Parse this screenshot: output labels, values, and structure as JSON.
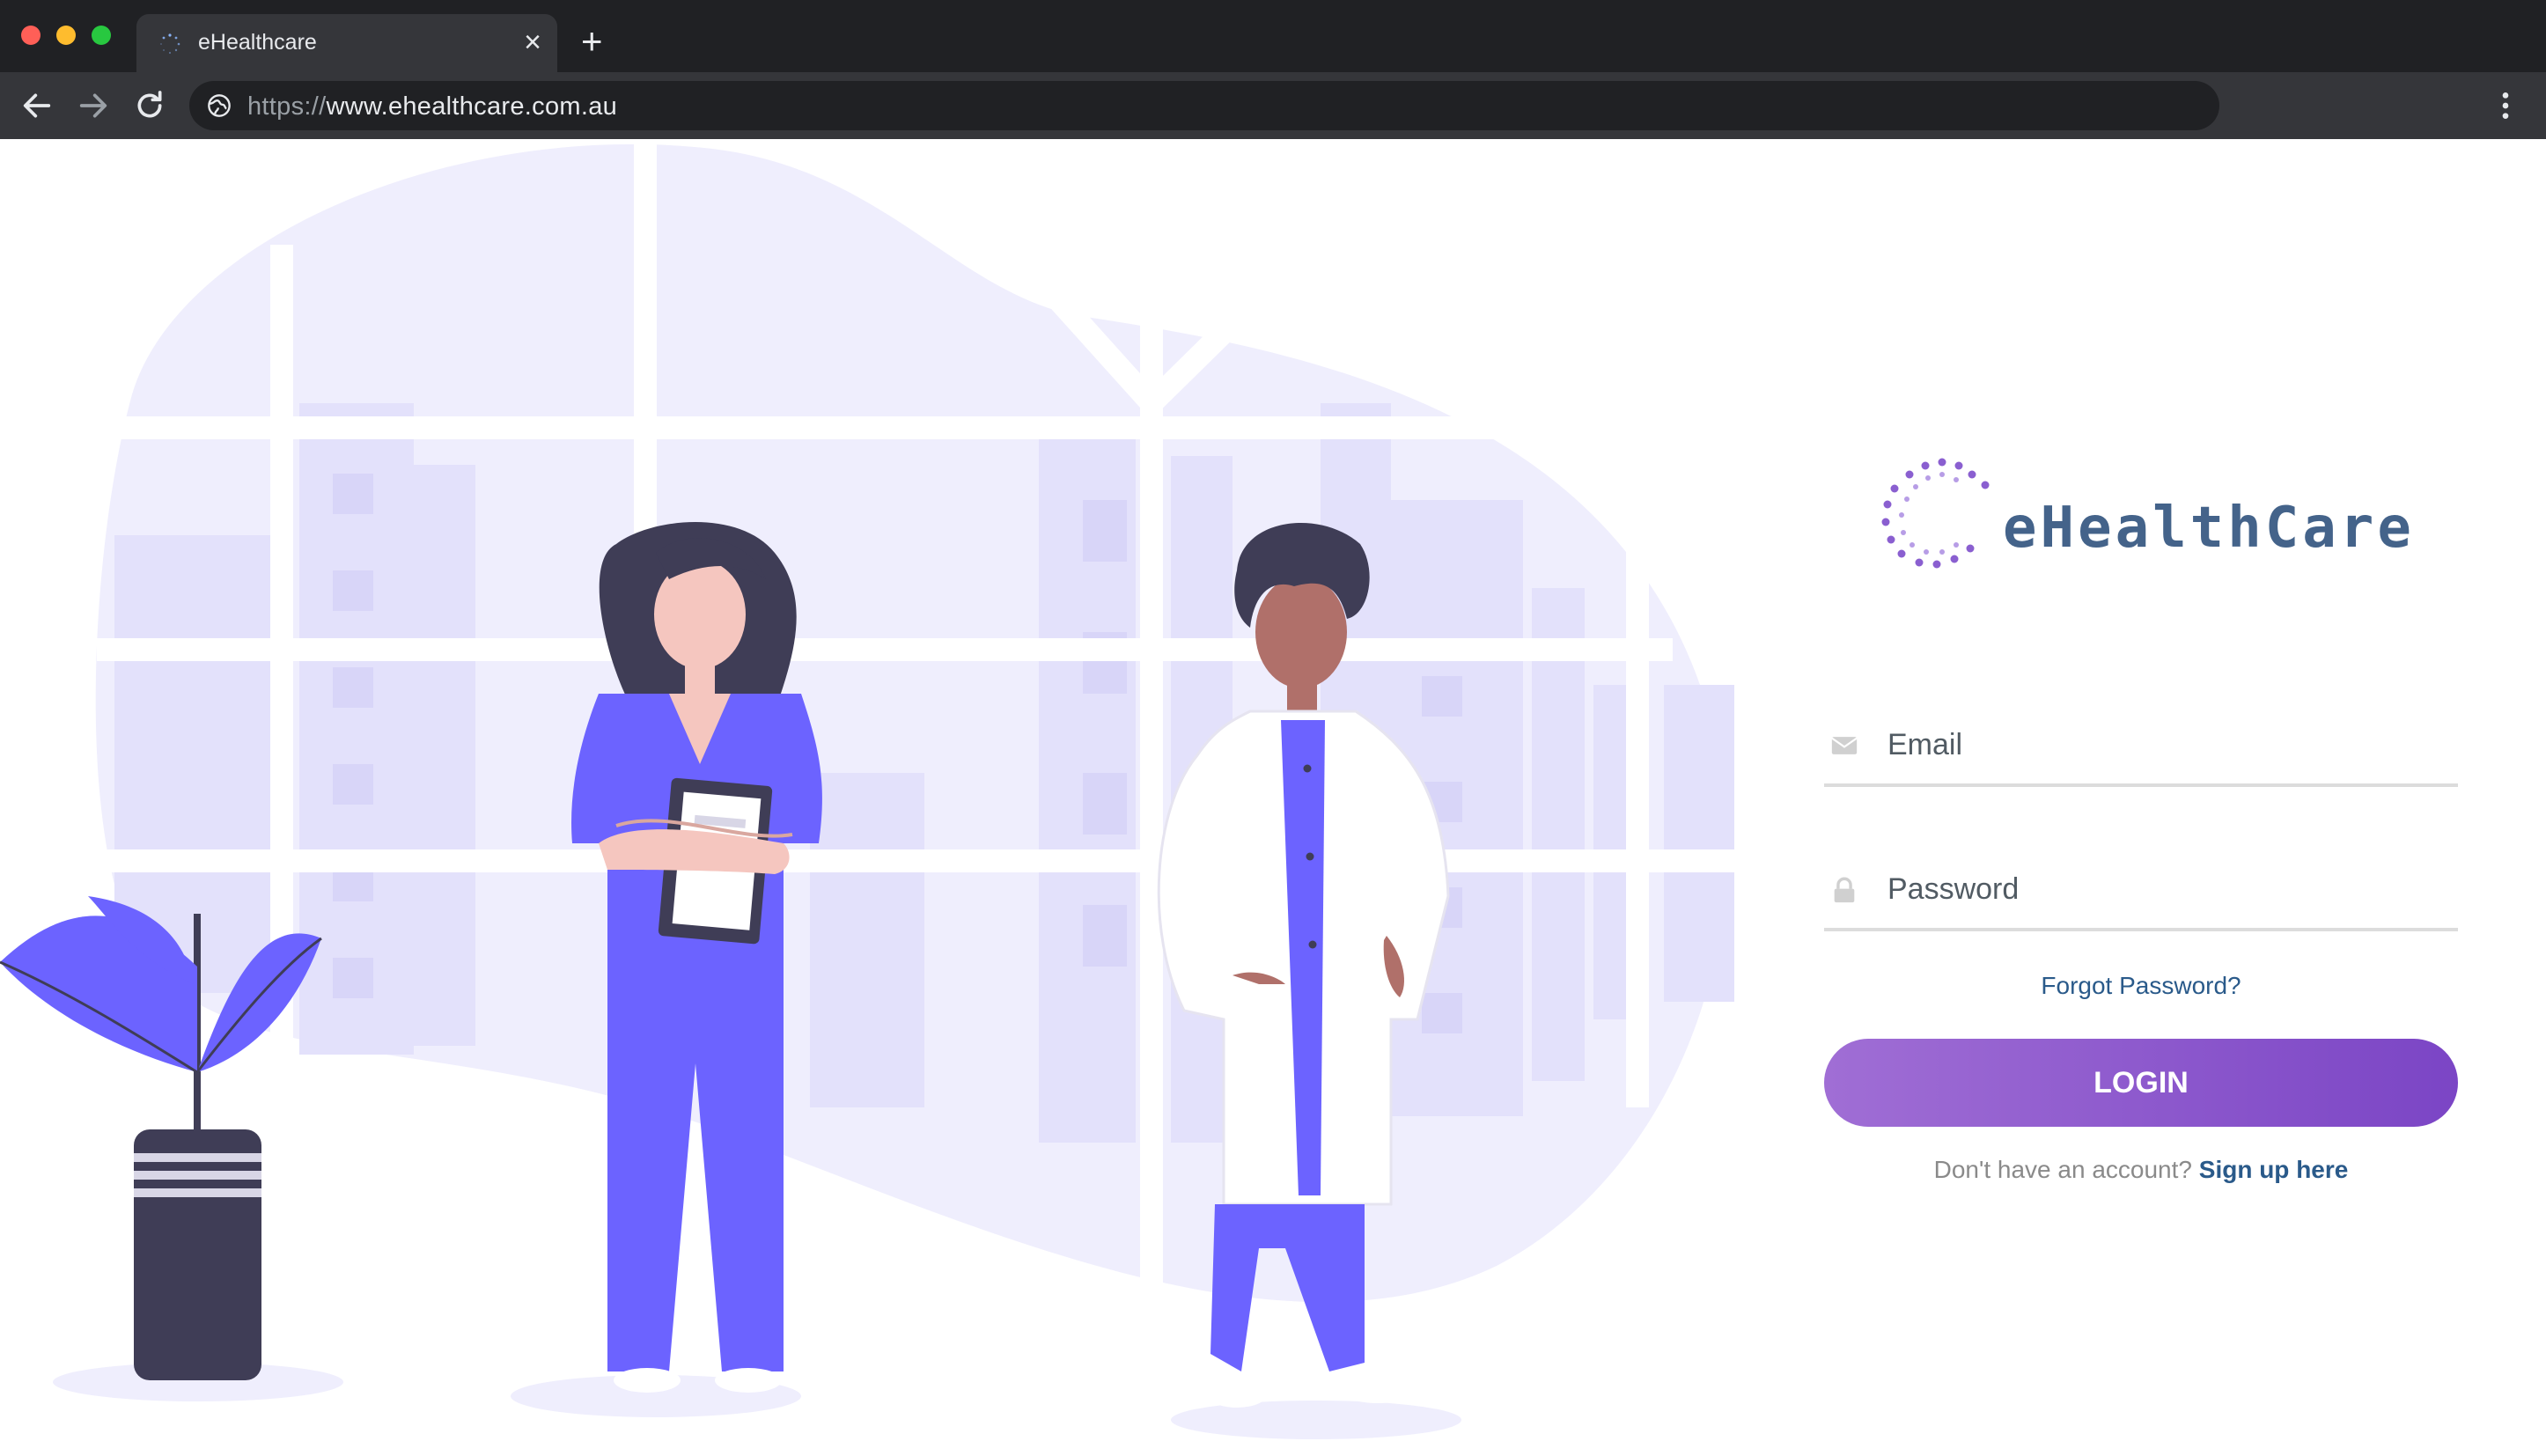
{
  "browser": {
    "tab_title": "eHealthcare",
    "new_tab_symbol": "+",
    "close_symbol": "×",
    "url_scheme": "https://",
    "url_host": "www.ehealthcare.com.au",
    "traffic_colors": [
      "#ff5f57",
      "#febc2e",
      "#28c840"
    ]
  },
  "brand": {
    "name": "eHealthCare",
    "color": "#44638a"
  },
  "login_form": {
    "email_placeholder": "Email",
    "password_placeholder": "Password",
    "forgot_label": "Forgot Password?",
    "login_label": "LOGIN",
    "no_account_text": "Don't have an account?",
    "signup_label": "Sign up here",
    "button_gradient": [
      "#a06ed5",
      "#7b45c5"
    ]
  },
  "icons": {
    "email": "envelope-icon",
    "password": "lock-icon",
    "nav": [
      "back-arrow-icon",
      "forward-arrow-icon",
      "reload-icon"
    ],
    "site_info": "globe-icon",
    "menu": "kebab-menu-icon"
  }
}
